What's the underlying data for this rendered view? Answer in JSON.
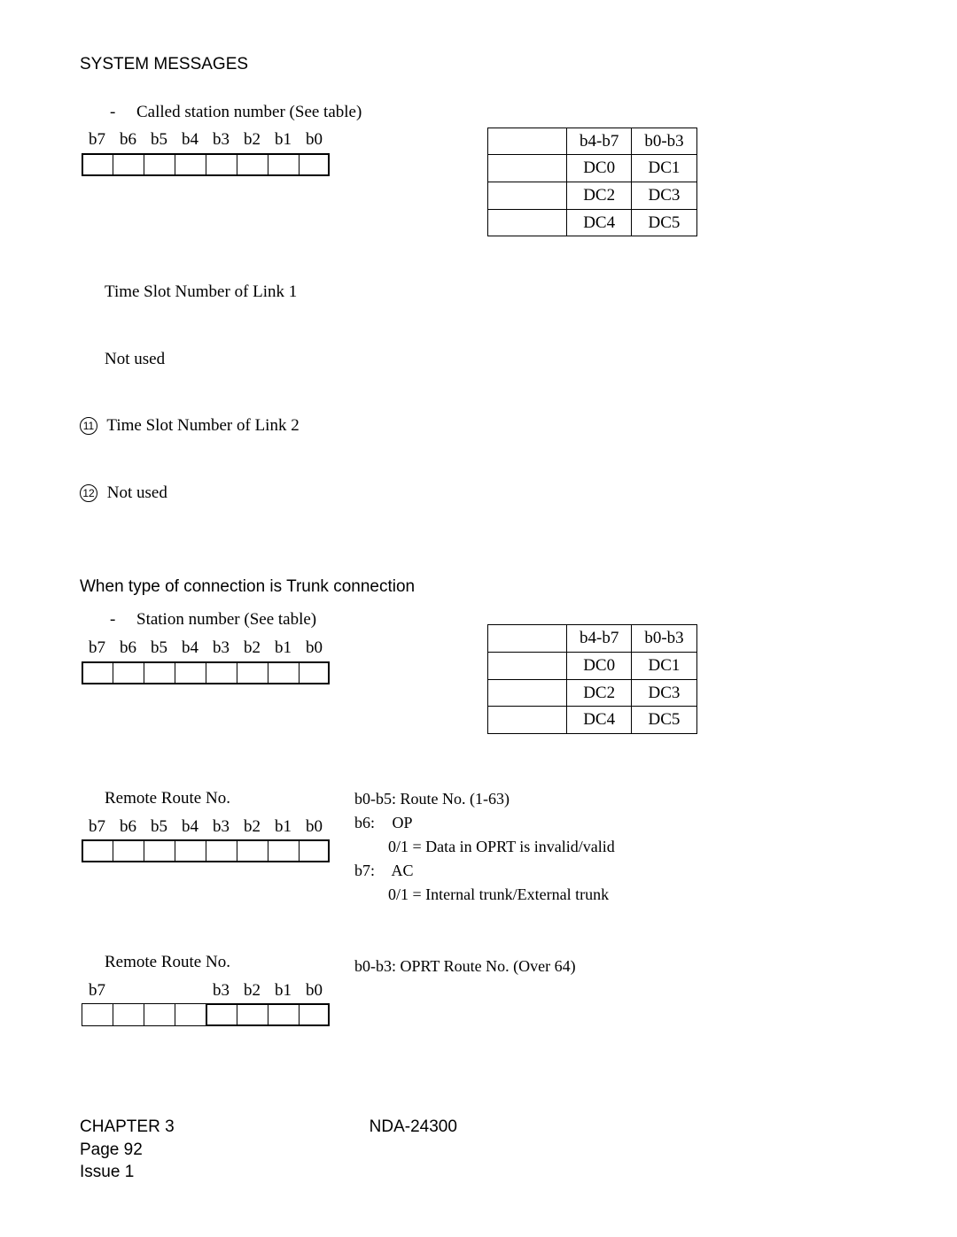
{
  "header": "SYSTEM MESSAGES",
  "section1": {
    "dash_label": "-",
    "dash_text": "Called station number (See table)",
    "bits": [
      "b7",
      "b6",
      "b5",
      "b4",
      "b3",
      "b2",
      "b1",
      "b0"
    ]
  },
  "dc_table": {
    "head": [
      "b4-b7",
      "b0-b3"
    ],
    "rows": [
      [
        "DC0",
        "DC1"
      ],
      [
        "DC2",
        "DC3"
      ],
      [
        "DC4",
        "DC5"
      ]
    ]
  },
  "items": {
    "l1": "Time Slot Number of Link 1",
    "l2": "Not used",
    "l3_num": "11",
    "l3": "Time Slot Number of Link 2",
    "l4_num": "12",
    "l4": "Not used"
  },
  "section2_heading": "When type of connection is Trunk connection",
  "section2": {
    "dash_label": "-",
    "dash_text": "Station number (See table)",
    "bits": [
      "b7",
      "b6",
      "b5",
      "b4",
      "b3",
      "b2",
      "b1",
      "b0"
    ]
  },
  "remote1": {
    "title": "Remote Route No.",
    "bits": [
      "b7",
      "b6",
      "b5",
      "b4",
      "b3",
      "b2",
      "b1",
      "b0"
    ],
    "desc_line1": "b0-b5: Route No. (1-63)",
    "desc_b6_label": "b6:",
    "desc_b6_val": "OP",
    "desc_b6_sub": "0/1 = Data in OPRT is invalid/valid",
    "desc_b7_label": "b7:",
    "desc_b7_val": "AC",
    "desc_b7_sub": "0/1 = Internal trunk/External trunk"
  },
  "remote2": {
    "title": "Remote Route No.",
    "bits": [
      "b7",
      "",
      "",
      "",
      "b3",
      "b2",
      "b1",
      "b0"
    ],
    "desc": "b0-b3: OPRT Route No. (Over 64)"
  },
  "footer": {
    "chapter": "CHAPTER 3",
    "page": "Page 92",
    "issue": "Issue 1",
    "doc": "NDA-24300"
  }
}
